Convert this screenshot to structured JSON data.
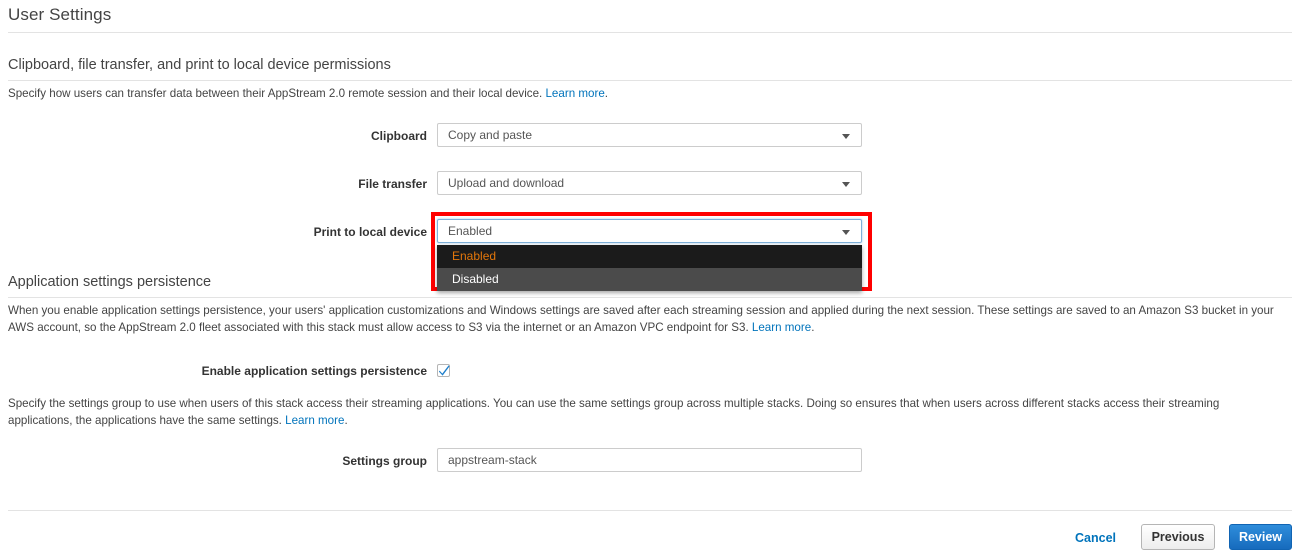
{
  "page": {
    "title": "User Settings"
  },
  "section_permissions": {
    "heading": "Clipboard, file transfer, and print to local device permissions",
    "description": "Specify how users can transfer data between their AppStream 2.0 remote session and their local device.",
    "learn_more": "Learn more",
    "fields": [
      {
        "label": "Clipboard",
        "value": "Copy and paste"
      },
      {
        "label": "File transfer",
        "value": "Upload and download"
      },
      {
        "label": "Print to local device",
        "value": "Enabled"
      }
    ],
    "print_dropdown": {
      "open": true,
      "options": [
        {
          "label": "Enabled",
          "selected": true
        },
        {
          "label": "Disabled",
          "selected": false
        }
      ],
      "highlight_color": "#ff0000",
      "selected_option_text_color": "#e2760b",
      "selected_option_bg": "#1b1b1b",
      "option_bg": "#4b4b4b"
    }
  },
  "section_persistence": {
    "heading": "Application settings persistence",
    "description": "When you enable application settings persistence, your users' application customizations and Windows settings are saved after each streaming session and applied during the next session. These settings are saved to an Amazon S3 bucket in your AWS account, so the AppStream 2.0 fleet associated with this stack must allow access to S3 via the internet or an Amazon VPC endpoint for S3.",
    "learn_more": "Learn more",
    "checkbox": {
      "label": "Enable application settings persistence",
      "checked": true
    },
    "settings_group_description": "Specify the settings group to use when users of this stack access their streaming applications. You can use the same settings group across multiple stacks. Doing so ensures that when users across different stacks access their streaming applications, the applications have the same settings.",
    "settings_group_learn_more": "Learn more",
    "settings_group_field": {
      "label": "Settings group",
      "value": "appstream-stack"
    }
  },
  "footer": {
    "cancel": "Cancel",
    "previous": "Previous",
    "review": "Review"
  },
  "colors": {
    "link": "#0073bb",
    "primary_button": "#1e7fcb",
    "text": "#444444",
    "rule": "#e3e3e3"
  }
}
